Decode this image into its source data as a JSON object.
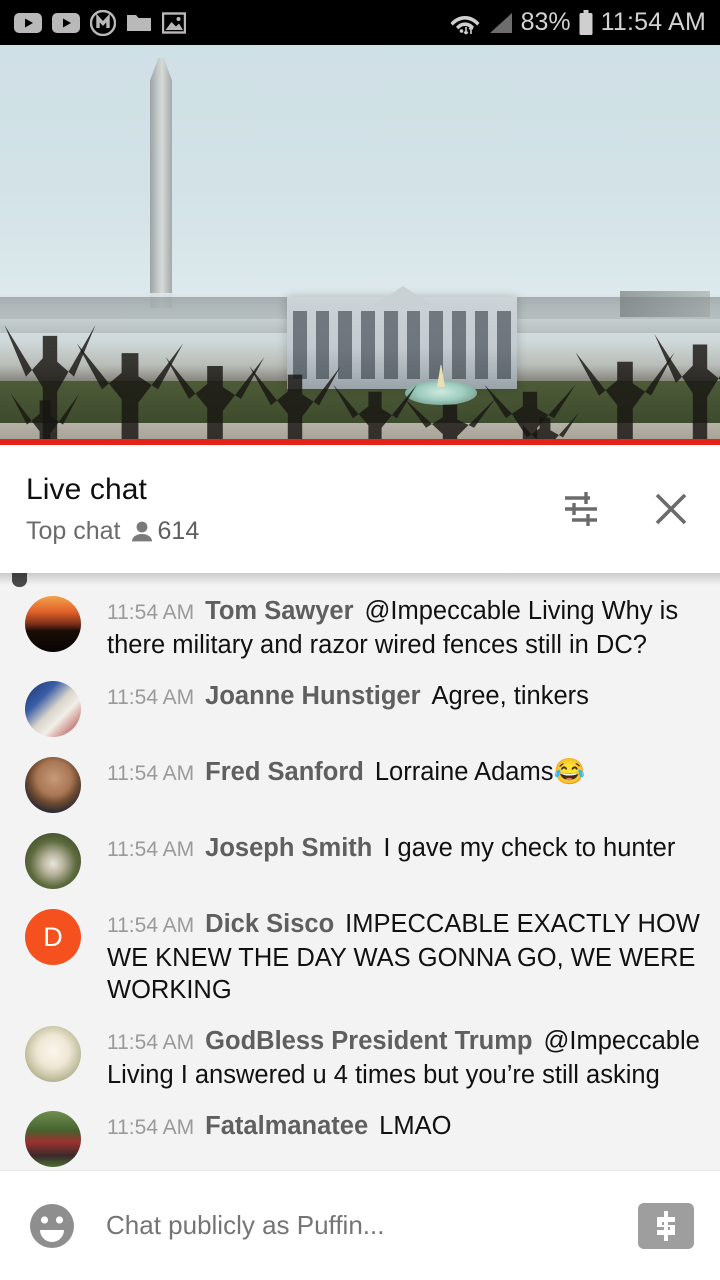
{
  "status_bar": {
    "icons": [
      "youtube-icon",
      "youtube-icon",
      "m-circle-icon",
      "folder-icon",
      "image-icon"
    ],
    "wifi": "wifi-icon",
    "signal": "cell-signal-icon",
    "battery_percent": "83%",
    "battery": "battery-icon",
    "time": "11:54 AM"
  },
  "video": {
    "scene": "Washington Monument and White House live view",
    "progress_color": "#e62117",
    "progress_percent": 100
  },
  "chat_header": {
    "title": "Live chat",
    "mode": "Top chat",
    "viewer_icon": "person-icon",
    "viewer_count": "614",
    "settings_icon": "chat-settings-icon",
    "close_icon": "close-icon"
  },
  "messages": [
    {
      "time": "11:54 AM",
      "author": "Tom Sawyer",
      "text": "@Impeccable Living Why is there military and razor wired fences still in DC?",
      "avatar": "av-sunset",
      "avatar_letter": ""
    },
    {
      "time": "11:54 AM",
      "author": "Joanne Hunstiger",
      "text": "Agree, tinkers",
      "avatar": "av-eagle",
      "avatar_letter": ""
    },
    {
      "time": "11:54 AM",
      "author": "Fred Sanford",
      "text": "Lorraine Adams😂",
      "avatar": "av-man",
      "avatar_letter": ""
    },
    {
      "time": "11:54 AM",
      "author": "Joseph Smith",
      "text": "I gave my check to hunter",
      "avatar": "av-panda",
      "avatar_letter": ""
    },
    {
      "time": "11:54 AM",
      "author": "Dick Sisco",
      "text": "IMPECCABLE EXACTLY HOW WE KNEW THE DAY WAS GONNA GO, WE WERE WORKING",
      "avatar": "av-dick",
      "avatar_letter": "D"
    },
    {
      "time": "11:54 AM",
      "author": "GodBless President Trump",
      "text": "@Impeccable Living I answered u 4 times but you’re still asking",
      "avatar": "av-puppy",
      "avatar_letter": ""
    },
    {
      "time": "11:54 AM",
      "author": "Fatalmanatee",
      "text": "LMAO",
      "avatar": "av-team",
      "avatar_letter": ""
    }
  ],
  "input_bar": {
    "emoji_icon": "emoji-smiley-icon",
    "placeholder": "Chat publicly as Puffin...",
    "value": "",
    "superchat_icon": "dollar-sign-icon"
  }
}
